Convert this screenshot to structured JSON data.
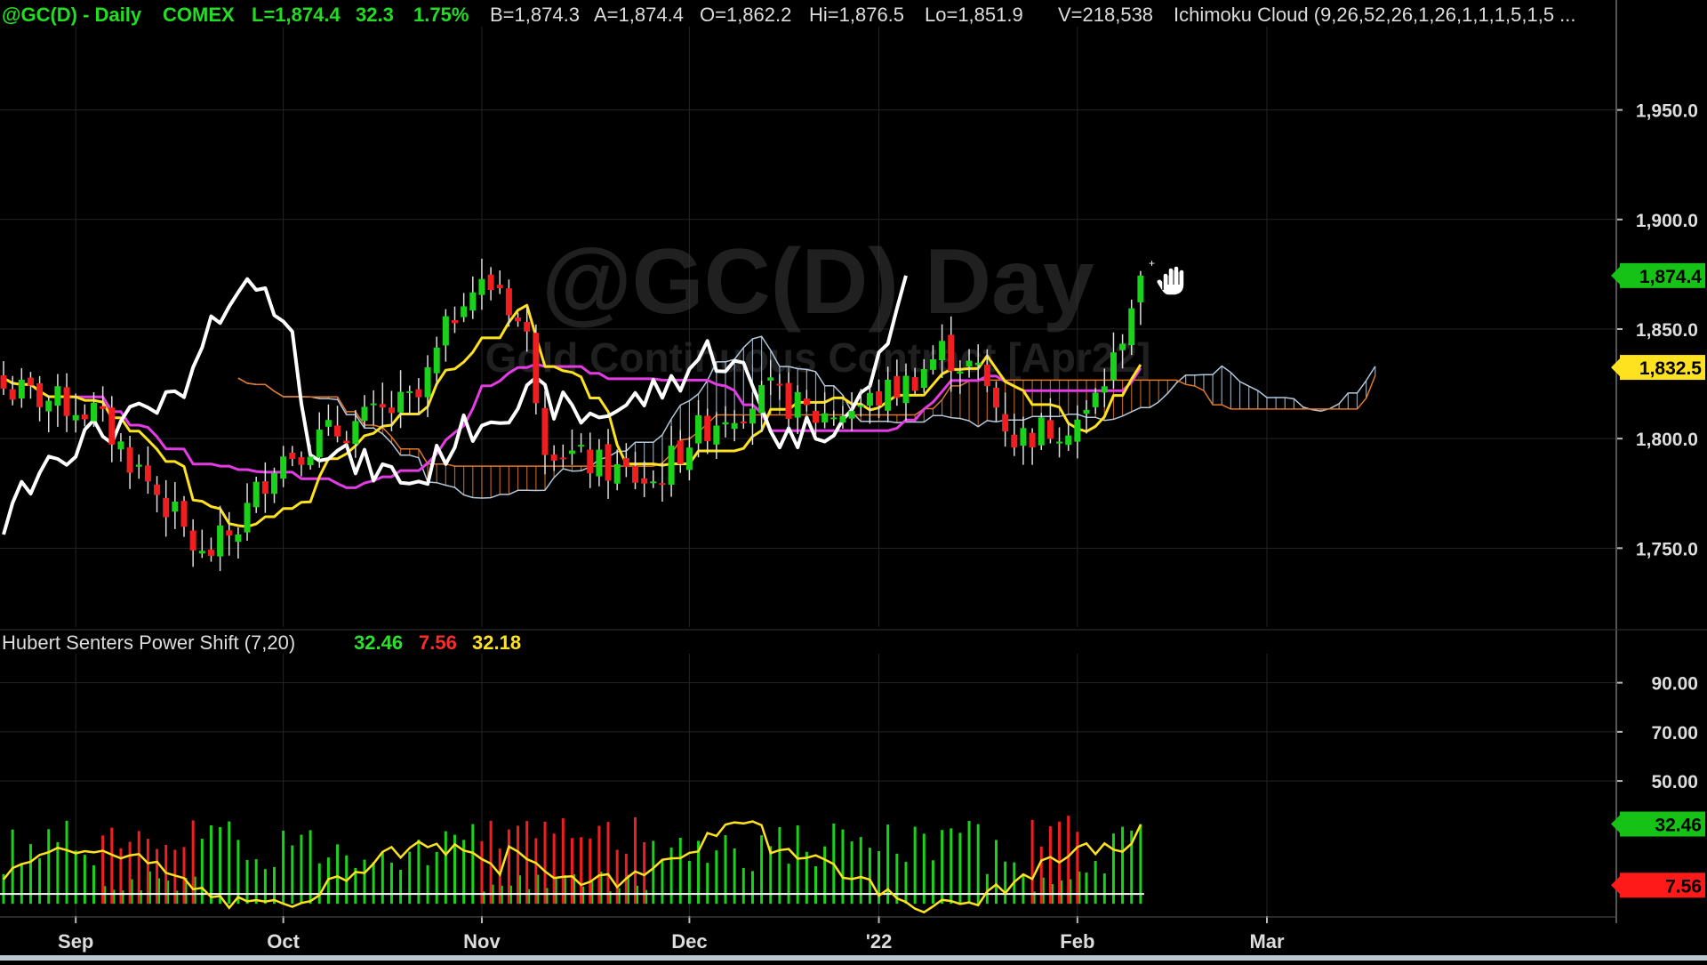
{
  "window": {
    "title": "@GC(D) - Daily COMEX"
  },
  "header": {
    "symbol": "@GC(D) - Daily",
    "exchange": "COMEX",
    "items": [
      {
        "text": "L=1,874.4"
      },
      {
        "text": "32.3"
      },
      {
        "text": "1.75%"
      },
      {
        "text": "B=1,874.3"
      },
      {
        "text": "A=1,874.4"
      },
      {
        "text": "O=1,862.2"
      },
      {
        "text": "Hi=1,876.5"
      },
      {
        "text": "Lo=1,851.9"
      },
      {
        "text": "V=218,538"
      }
    ],
    "indicator": "Ichimoku Cloud (9,26,52,26,1,26,1,1,1,5,1,5 ..."
  },
  "watermark": {
    "big": "@GC(D) Day",
    "small": "Gold Continuous Contract [Apr22]"
  },
  "lower_header": {
    "title": "Hubert Senters Power Shift (7,20)",
    "values": [
      {
        "text": "32.46",
        "color": "#2ee02e"
      },
      {
        "text": "7.56",
        "color": "#ff2a2a"
      },
      {
        "text": "32.18",
        "color": "#ffe21f"
      }
    ]
  },
  "price_tags": [
    {
      "text": "1,874.4",
      "value": 1874.4,
      "bg": "#17c217",
      "fg": "#000000"
    },
    {
      "text": "1,832.5",
      "value": 1832.5,
      "bg": "#ffe21f",
      "fg": "#000000",
      "under": "#e43ce4"
    }
  ],
  "lower_tags": [
    {
      "text": "32.46",
      "value": 32.46,
      "bg": "#17c217",
      "fg": "#000000"
    },
    {
      "text": "7.56",
      "value": 7.56,
      "bg": "#ff1a1a",
      "fg": "#000000"
    }
  ],
  "colors": {
    "up": "#1bd21b",
    "down": "#f01e1e",
    "tenkan": "#ffe21f",
    "kijun": "#e43ce4",
    "chikou": "#ffffff",
    "span_a": "#b4c8dc",
    "span_b": "#e07828",
    "grid": "#242424"
  },
  "chart_data": [
    {
      "type": "candlestick",
      "title": "@GC(D) - Daily",
      "x_axis": {
        "ticks": [
          "Sep",
          "Oct",
          "Nov",
          "Dec",
          "'22",
          "Feb",
          "Mar"
        ]
      },
      "y_axis": {
        "ticks": [
          "1,750.0",
          "1,800.0",
          "1,850.0",
          "1,900.0",
          "1,950.0"
        ],
        "range": [
          1714,
          1988
        ]
      },
      "last": 1874.4,
      "series_points": [
        {
          "name": "close_keypoints",
          "values": [
            [
              0,
              1823
            ],
            [
              10,
              1812
            ],
            [
              18,
              1770
            ],
            [
              22,
              1745
            ],
            [
              26,
              1760
            ],
            [
              30,
              1790
            ],
            [
              35,
              1800
            ],
            [
              40,
              1808
            ],
            [
              46,
              1818
            ],
            [
              51,
              1868
            ],
            [
              55,
              1870
            ],
            [
              58,
              1845
            ],
            [
              60,
              1800
            ],
            [
              64,
              1790
            ],
            [
              68,
              1785
            ],
            [
              72,
              1780
            ],
            [
              76,
              1800
            ],
            [
              80,
              1812
            ],
            [
              85,
              1820
            ],
            [
              90,
              1810
            ],
            [
              95,
              1815
            ],
            [
              100,
              1825
            ],
            [
              104,
              1840
            ],
            [
              108,
              1830
            ],
            [
              112,
              1800
            ],
            [
              116,
              1805
            ],
            [
              120,
              1810
            ],
            [
              123,
              1835
            ],
            [
              125,
              1862
            ],
            [
              126,
              1874.4
            ]
          ]
        }
      ]
    },
    {
      "type": "bar",
      "title": "Hubert Senters Power Shift (7,20)",
      "y_axis": {
        "ticks": [
          "50.00",
          "70.00",
          "90.00"
        ],
        "range": [
          -5,
          100
        ]
      },
      "last_values": {
        "green": 32.46,
        "red": 7.56,
        "yellow": 32.18
      }
    }
  ]
}
